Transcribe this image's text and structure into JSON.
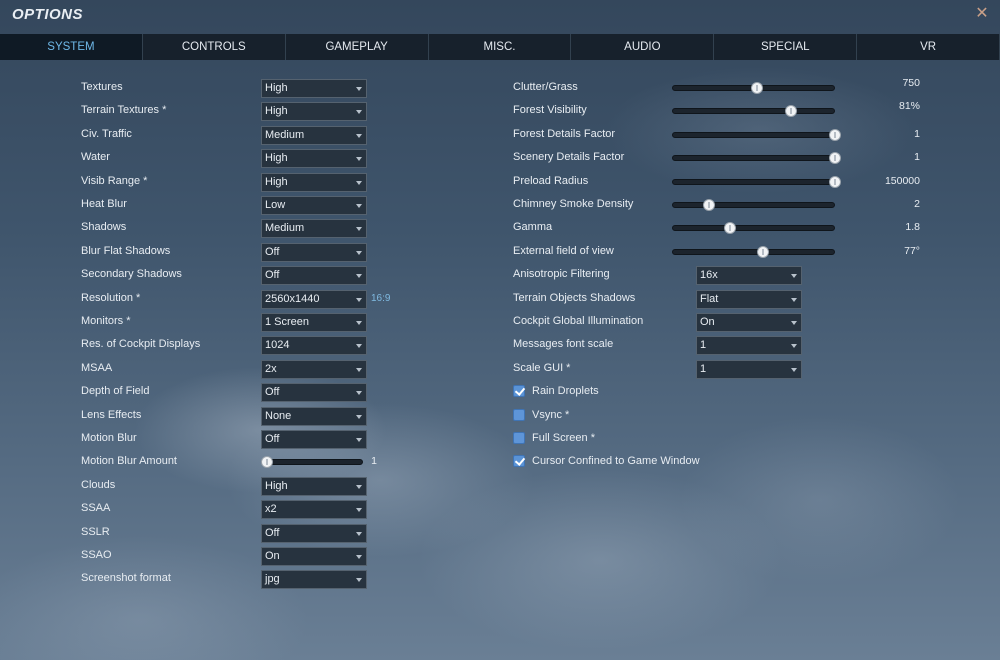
{
  "window": {
    "title": "OPTIONS",
    "close_icon": "close-icon"
  },
  "tabs": [
    "SYSTEM",
    "CONTROLS",
    "GAMEPLAY",
    "MISC.",
    "AUDIO",
    "SPECIAL",
    "VR"
  ],
  "active_tab": "SYSTEM",
  "left": [
    {
      "label": "Textures",
      "value": "High"
    },
    {
      "label": "Terrain Textures *",
      "value": "High"
    },
    {
      "label": "Civ. Traffic",
      "value": "Medium"
    },
    {
      "label": "Water",
      "value": "High"
    },
    {
      "label": "Visib Range *",
      "value": "High"
    },
    {
      "label": "Heat Blur",
      "value": "Low"
    },
    {
      "label": "Shadows",
      "value": "Medium"
    },
    {
      "label": "Blur Flat Shadows",
      "value": "Off"
    },
    {
      "label": "Secondary Shadows",
      "value": "Off"
    },
    {
      "label": "Resolution *",
      "value": "2560x1440"
    },
    {
      "label": "Monitors *",
      "value": "1 Screen"
    },
    {
      "label": "Res. of Cockpit Displays",
      "value": "1024"
    },
    {
      "label": "MSAA",
      "value": "2x"
    },
    {
      "label": "Depth of Field",
      "value": "Off"
    },
    {
      "label": "Lens Effects",
      "value": "None"
    },
    {
      "label": "Motion Blur",
      "value": "Off"
    },
    {
      "label": "Motion Blur Amount",
      "value": "1"
    },
    {
      "label": "Clouds",
      "value": "High"
    },
    {
      "label": "SSAA",
      "value": "x2"
    },
    {
      "label": "SSLR",
      "value": "Off"
    },
    {
      "label": "SSAO",
      "value": "On"
    },
    {
      "label": "Screenshot format",
      "value": "jpg"
    }
  ],
  "resolution_aspect": "16:9",
  "motion_blur_amount_level": 0,
  "right_sliders": [
    {
      "label": "Clutter/Grass",
      "value": "750",
      "level": 0.5
    },
    {
      "label": "Forest Visibility",
      "value": "81%",
      "level": 0.72
    },
    {
      "label": "Forest Details Factor",
      "value": "1",
      "level": 1.0
    },
    {
      "label": "Scenery Details Factor",
      "value": "1",
      "level": 1.0
    },
    {
      "label": "Preload Radius",
      "value": "150000",
      "level": 1.0
    },
    {
      "label": "Chimney Smoke Density",
      "value": "2",
      "level": 0.2
    },
    {
      "label": "Gamma",
      "value": "1.8",
      "level": 0.33
    },
    {
      "label": "External field of view",
      "value": "77°",
      "level": 0.54
    }
  ],
  "right_selects": [
    {
      "label": "Anisotropic Filtering",
      "value": "16x"
    },
    {
      "label": "Terrain Objects Shadows",
      "value": "Flat"
    },
    {
      "label": "Cockpit Global Illumination",
      "value": "On"
    },
    {
      "label": "Messages font scale",
      "value": "1"
    },
    {
      "label": "Scale GUI *",
      "value": "1"
    }
  ],
  "checkboxes": [
    {
      "label": "Rain Droplets",
      "checked": true
    },
    {
      "label": "Vsync *",
      "checked": false
    },
    {
      "label": "Full Screen *",
      "checked": false
    },
    {
      "label": "Cursor Confined to Game Window",
      "checked": true
    }
  ],
  "colors": {
    "accent": "#6fb8e8",
    "tab_bar": "#17212c",
    "checkbox": "#5a93d6"
  }
}
